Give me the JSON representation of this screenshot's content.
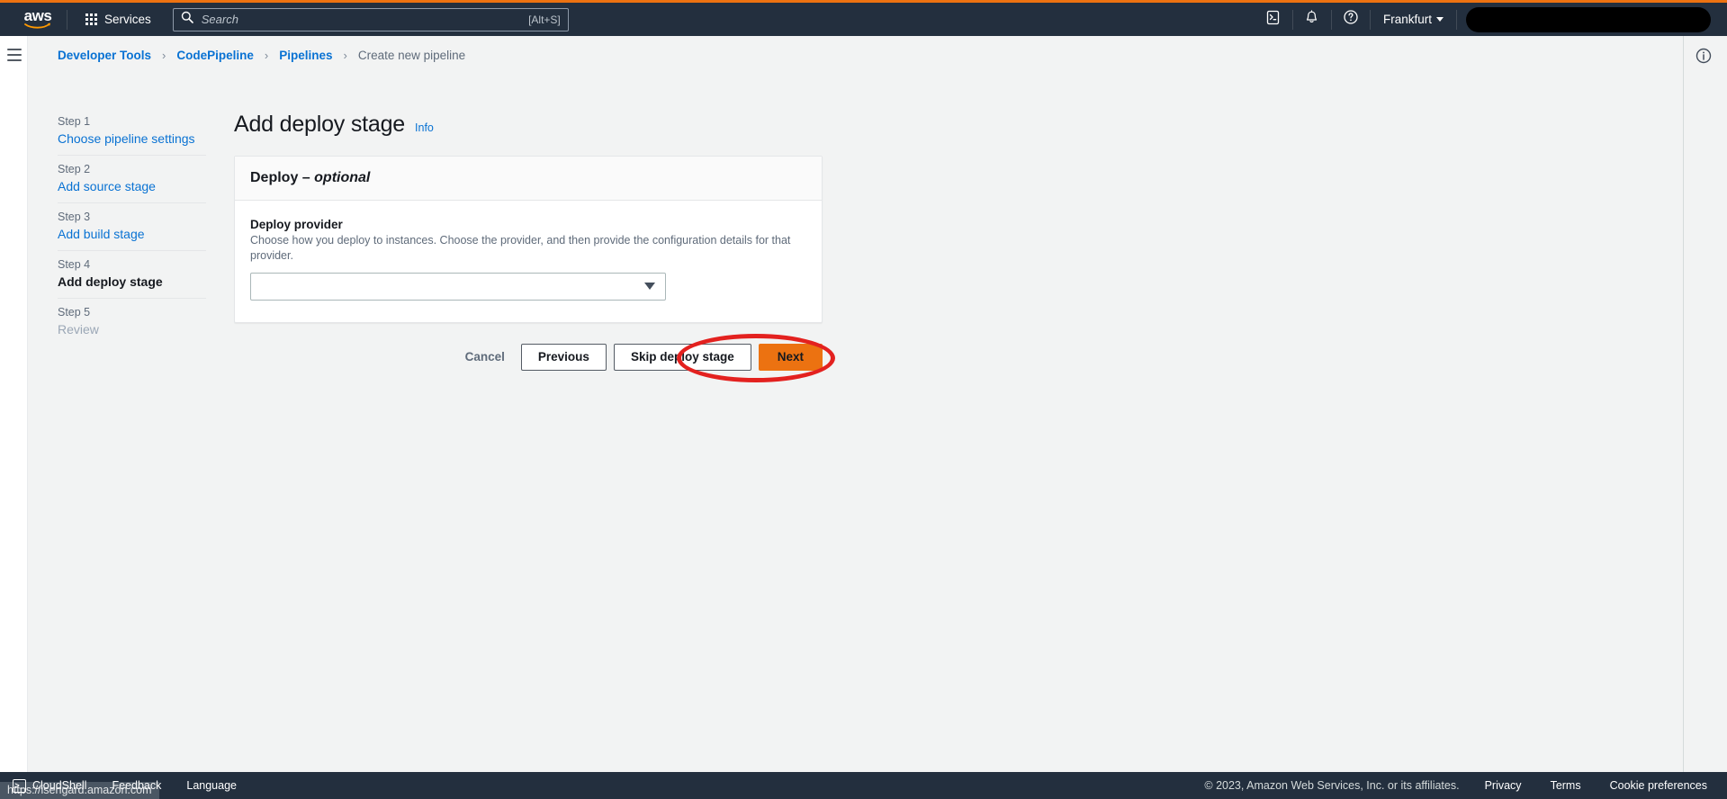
{
  "topnav": {
    "logo_alt": "aws",
    "services_label": "Services",
    "search_placeholder": "Search",
    "search_value": "",
    "search_shortcut": "[Alt+S]",
    "region_label": "Frankfurt",
    "account_label": "",
    "icons": {
      "grid": "services-grid-icon",
      "search": "search-icon",
      "cloudshell": "cloudshell-icon",
      "bell": "notifications-bell-icon",
      "help": "help-question-icon"
    }
  },
  "breadcrumb": {
    "items": [
      {
        "label": "Developer Tools",
        "current": false
      },
      {
        "label": "CodePipeline",
        "current": false
      },
      {
        "label": "Pipelines",
        "current": false
      },
      {
        "label": "Create new pipeline",
        "current": true
      }
    ],
    "separator": "›"
  },
  "steps": [
    {
      "num": "Step 1",
      "name": "Choose pipeline settings",
      "state": "link"
    },
    {
      "num": "Step 2",
      "name": "Add source stage",
      "state": "link"
    },
    {
      "num": "Step 3",
      "name": "Add build stage",
      "state": "link"
    },
    {
      "num": "Step 4",
      "name": "Add deploy stage",
      "state": "current"
    },
    {
      "num": "Step 5",
      "name": "Review",
      "state": "disabled"
    }
  ],
  "main": {
    "title": "Add deploy stage",
    "info_label": "Info",
    "card": {
      "header_title": "Deploy",
      "header_dash": " – ",
      "header_optional": "optional",
      "field_label": "Deploy provider",
      "field_desc": "Choose how you deploy to instances. Choose the provider, and then provide the configuration details for that provider.",
      "select_value": "",
      "select_placeholder": ""
    },
    "actions": {
      "cancel": "Cancel",
      "previous": "Previous",
      "skip": "Skip deploy stage",
      "next": "Next"
    }
  },
  "annotation": {
    "shape": "red-ellipse-highlight",
    "target": "Skip deploy stage",
    "color": "#e3211f"
  },
  "right_rail": {
    "info_icon": "info-circle-icon"
  },
  "footer": {
    "cloudshell": "CloudShell",
    "feedback": "Feedback",
    "language": "Language",
    "copyright": "© 2023, Amazon Web Services, Inc. or its affiliates.",
    "privacy": "Privacy",
    "terms": "Terms",
    "cookie_preferences": "Cookie preferences",
    "status_url": "https://isengard.amazon.com"
  },
  "colors": {
    "nav_bg": "#232f3e",
    "accent_orange": "#ec7211",
    "link_blue": "#0972d3",
    "page_bg": "#f2f3f3",
    "annotation_red": "#e3211f"
  }
}
